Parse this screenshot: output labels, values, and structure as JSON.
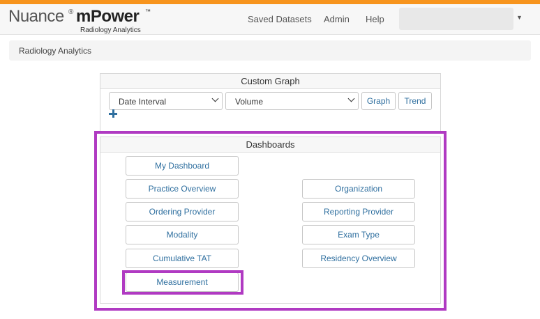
{
  "brand": {
    "name": "Nuance",
    "reg": "®",
    "product": "mPower",
    "tm": "™",
    "subtitle": "Radiology Analytics"
  },
  "nav": {
    "items": [
      "Saved Datasets",
      "Admin",
      "Help"
    ]
  },
  "breadcrumb": {
    "label": "Radiology Analytics"
  },
  "custom_graph": {
    "title": "Custom Graph",
    "interval_select": "Date Interval",
    "metric_select": "Volume",
    "graph_button": "Graph",
    "trend_button": "Trend"
  },
  "dashboards": {
    "title": "Dashboards",
    "left": [
      "My Dashboard",
      "Practice Overview",
      "Ordering Provider",
      "Modality",
      "Cumulative TAT",
      "Measurement"
    ],
    "right": [
      "Organization",
      "Reporting Provider",
      "Exam Type",
      "Residency Overview"
    ]
  },
  "colors": {
    "accent": "#f7941d",
    "link": "#2f6f9f",
    "highlight": "#b03ac2"
  }
}
